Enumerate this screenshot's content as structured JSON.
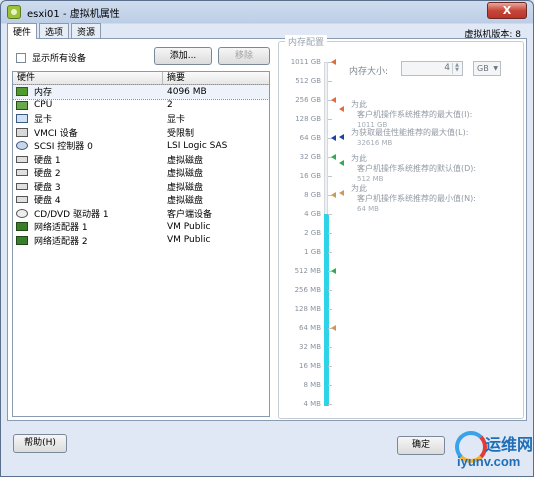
{
  "window": {
    "title": "esxi01 - 虚拟机属性",
    "close_label": "X"
  },
  "tabs": [
    {
      "label": "硬件"
    },
    {
      "label": "选项"
    },
    {
      "label": "资源"
    }
  ],
  "version": "虚拟机版本: 8",
  "show_all_devices": "显示所有设备",
  "buttons": {
    "add": "添加...",
    "remove": "移除",
    "help": "帮助(H)",
    "ok": "确定"
  },
  "hardware_table": {
    "headers": [
      "硬件",
      "摘要"
    ],
    "rows": [
      {
        "name": "内存",
        "summary": "4096 MB",
        "icon": "memory-icon"
      },
      {
        "name": "CPU",
        "summary": "2",
        "icon": "cpu-icon"
      },
      {
        "name": "显卡",
        "summary": "显卡",
        "icon": "display-icon"
      },
      {
        "name": "VMCI 设备",
        "summary": "受限制",
        "icon": "vmci-icon"
      },
      {
        "name": "SCSI 控制器 0",
        "summary": "LSI Logic SAS",
        "icon": "scsi-icon"
      },
      {
        "name": "硬盘 1",
        "summary": "虚拟磁盘",
        "icon": "disk-icon"
      },
      {
        "name": "硬盘 2",
        "summary": "虚拟磁盘",
        "icon": "disk-icon"
      },
      {
        "name": "硬盘 3",
        "summary": "虚拟磁盘",
        "icon": "disk-icon"
      },
      {
        "name": "硬盘 4",
        "summary": "虚拟磁盘",
        "icon": "disk-icon"
      },
      {
        "name": "CD/DVD 驱动器 1",
        "summary": "客户端设备",
        "icon": "cdrom-icon"
      },
      {
        "name": "网络适配器 1",
        "summary": "VM Public",
        "icon": "network-icon"
      },
      {
        "name": "网络适配器 2",
        "summary": "VM Public",
        "icon": "network-icon"
      }
    ]
  },
  "memory_config": {
    "legend": "内存配置",
    "size_label": "内存大小:",
    "size_value": "4",
    "unit": "GB",
    "scale": [
      "1011 GB",
      "512 GB",
      "256 GB",
      "128 GB",
      "64 GB",
      "32 GB",
      "16 GB",
      "8 GB",
      "4 GB",
      "2 GB",
      "1 GB",
      "512 MB",
      "256 MB",
      "128 MB",
      "64 MB",
      "32 MB",
      "16 MB",
      "8 MB",
      "4 MB"
    ],
    "current_level": "4 GB",
    "notes": [
      {
        "line1": "为此",
        "line2": "客户机操作系统推荐的最大值(I):",
        "value": "1011 GB",
        "color": "#e06c3c"
      },
      {
        "line1": "为获取最佳性能推荐的最大值(L):",
        "line2": "",
        "value": "32616 MB",
        "color": "#1d3fa8"
      },
      {
        "line1": "为此",
        "line2": "客户机操作系统推荐的默认值(D):",
        "value": "512 MB",
        "color": "#34a853"
      },
      {
        "line1": "为此",
        "line2": "客户机操作系统推荐的最小值(N):",
        "value": "64 MB",
        "color": "#c99a5a"
      }
    ]
  },
  "watermark": {
    "line1": "运维网",
    "line2": "iyunv.com"
  }
}
